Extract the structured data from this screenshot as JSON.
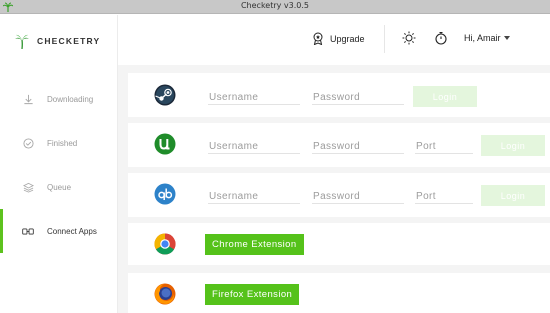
{
  "window": {
    "title": "Checketry v3.0.5"
  },
  "brand": {
    "name": "CHECKETRY"
  },
  "sidebar": {
    "items": [
      {
        "label": "Downloading",
        "icon": "download-icon"
      },
      {
        "label": "Finished",
        "icon": "check-circle-icon"
      },
      {
        "label": "Queue",
        "icon": "layers-icon"
      },
      {
        "label": "Connect Apps",
        "icon": "link-icon",
        "active": true
      }
    ]
  },
  "header": {
    "upgrade_label": "Upgrade",
    "user_label": "Hi, Amair",
    "icons": [
      "medal-icon",
      "sun-icon",
      "timer-icon",
      "chevron-down-icon"
    ]
  },
  "apps": {
    "steam": {
      "icon": "steam-icon",
      "username_placeholder": "Username",
      "password_placeholder": "Password",
      "login_label": "Login"
    },
    "utorrent": {
      "icon": "utorrent-icon",
      "username_placeholder": "Username",
      "password_placeholder": "Password",
      "port_placeholder": "Port",
      "login_label": "Login"
    },
    "qbittorrent": {
      "icon": "qbittorrent-icon",
      "username_placeholder": "Username",
      "password_placeholder": "Password",
      "port_placeholder": "Port",
      "login_label": "Login"
    },
    "chrome": {
      "icon": "chrome-icon",
      "button_label": "Chrome Extension"
    },
    "firefox": {
      "icon": "firefox-icon",
      "button_label": "Firefox Extension"
    }
  },
  "colors": {
    "accent": "#5dc21e",
    "button_green": "#55c21a",
    "login_disabled": "#e4f6dd",
    "main_bg": "#f4f4f4",
    "sidebar_text": "#9a9a9a"
  }
}
